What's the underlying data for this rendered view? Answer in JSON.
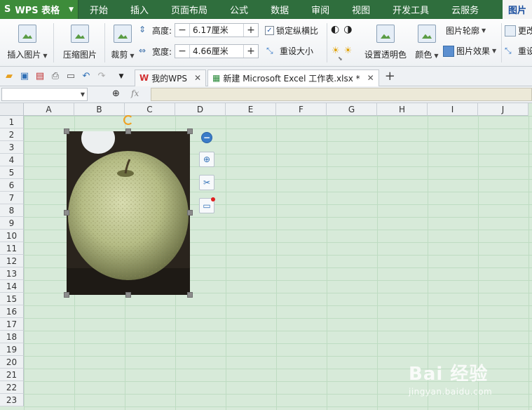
{
  "app": {
    "logo": "S",
    "name": "WPS 表格"
  },
  "menu": {
    "tabs": [
      "开始",
      "插入",
      "页面布局",
      "公式",
      "数据",
      "审阅",
      "视图",
      "开发工具",
      "云服务"
    ],
    "active_tab": "图片"
  },
  "ribbon": {
    "insert_picture": "插入图片",
    "compress_picture": "压缩图片",
    "crop": "裁剪",
    "height_label": "高度:",
    "height_value": "6.17厘米",
    "width_label": "宽度:",
    "width_value": "4.66厘米",
    "lock_ratio": "锁定纵横比",
    "lock_ratio_checked": true,
    "reset_size": "重设大小",
    "set_transparent": "设置透明色",
    "color": "颜色",
    "picture_outline": "图片轮廓",
    "picture_effect": "图片效果",
    "change_picture": "更改",
    "reset": "重设"
  },
  "doc_tabs": [
    {
      "label": "我的WPS",
      "active": false
    },
    {
      "label": "新建 Microsoft Excel 工作表.xlsx *",
      "active": true
    }
  ],
  "formula_bar": {
    "fx": "fx",
    "name_box": "",
    "formula": ""
  },
  "sheet": {
    "columns": [
      "A",
      "B",
      "C",
      "D",
      "E",
      "F",
      "G",
      "H",
      "I",
      "J"
    ],
    "rows": [
      "1",
      "2",
      "3",
      "4",
      "5",
      "6",
      "7",
      "8",
      "9",
      "10",
      "11",
      "12",
      "13",
      "14",
      "15",
      "16",
      "17",
      "18",
      "19",
      "20",
      "21",
      "22",
      "23"
    ]
  },
  "picture": {
    "subject": "pear-photo"
  },
  "watermark": {
    "brand": "Bai 经验",
    "url": "jingyan.baidu.com"
  },
  "colors": {
    "menubar": "#2f6e3d",
    "app_button": "#3d8c3a",
    "sheet_bg": "#d7ead9",
    "accent": "#2f6fb6"
  }
}
